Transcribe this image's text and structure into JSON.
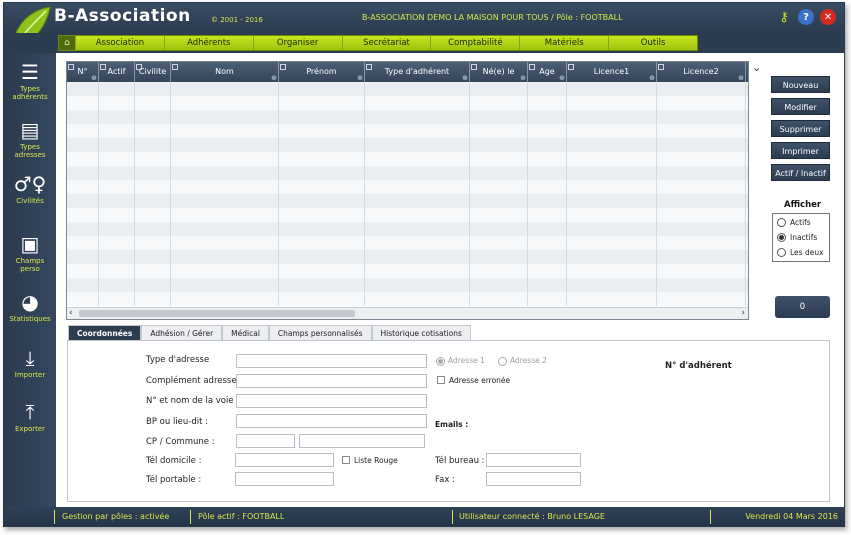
{
  "header": {
    "title": "B-Association",
    "copyright": "© 2001 - 2016",
    "info": "B-ASSOCIATION DEMO LA MAISON POUR TOUS / Pôle : FOOTBALL",
    "icons": [
      "key-icon",
      "help-icon",
      "close-icon"
    ]
  },
  "menu": {
    "items": [
      "Association",
      "Adhérents",
      "Organiser",
      "Secrétariat",
      "Comptabilité",
      "Matériels",
      "Outils"
    ]
  },
  "sidebar": {
    "items": [
      {
        "label1": "Types",
        "label2": "adhérents",
        "icon": "member-types-icon"
      },
      {
        "label1": "Types",
        "label2": "adresses",
        "icon": "address-types-icon"
      },
      {
        "label1": "Civilités",
        "label2": "",
        "icon": "civilities-icon"
      },
      {
        "label1": "Champs",
        "label2": "perso",
        "icon": "custom-fields-icon"
      },
      {
        "label1": "Statistiques",
        "label2": "",
        "icon": "statistics-icon"
      },
      {
        "label1": "Importer",
        "label2": "",
        "icon": "import-icon"
      },
      {
        "label1": "Exporter",
        "label2": "",
        "icon": "export-icon"
      }
    ]
  },
  "grid": {
    "columns": [
      "N°",
      "Actif",
      "Civilite",
      "Nom",
      "Prénom",
      "Type d'adhérent",
      "Né(e) le",
      "Age",
      "Licence1",
      "Licence2"
    ]
  },
  "actions": {
    "new": "Nouveau",
    "edit": "Modifier",
    "delete": "Supprimer",
    "print": "Imprimer",
    "toggle_active": "Actif / Inactif"
  },
  "display": {
    "title": "Afficher",
    "options": [
      "Actifs",
      "Inactifs",
      "Les deux"
    ],
    "selected": "Inactifs"
  },
  "count": "0",
  "tabs": [
    "Coordonnées",
    "Adhésion / Gérer",
    "Médical",
    "Champs personnalisés",
    "Historique cotisations"
  ],
  "form": {
    "type_adresse": "Type d'adresse",
    "complement": "Complément adresse :",
    "voie": "N° et nom de la voie :",
    "bp": "BP ou lieu-dit :",
    "cp": "CP / Commune :",
    "tel_domicile": "Tél domicile :",
    "tel_portable": "Tél portable :",
    "adresse1": "Adresse 1",
    "adresse2": "Adresse 2",
    "adresse_erronee": "Adresse erronée",
    "emails": "Emails :",
    "liste_rouge": "Liste Rouge",
    "tel_bureau": "Tél bureau :",
    "fax": "Fax :",
    "num_adherent": "N° d'adhérent"
  },
  "status": {
    "poles": "Gestion par pôles : activée",
    "pole_actif": "Pôle actif : FOOTBALL",
    "user": "Utilisateur connecté : Bruno LESAGE",
    "date": "Vendredi 04 Mars 2016"
  },
  "colors": {
    "navy": "#2b3b50",
    "accent_green": "#b5d416",
    "status_yellow": "#d8e84a"
  }
}
